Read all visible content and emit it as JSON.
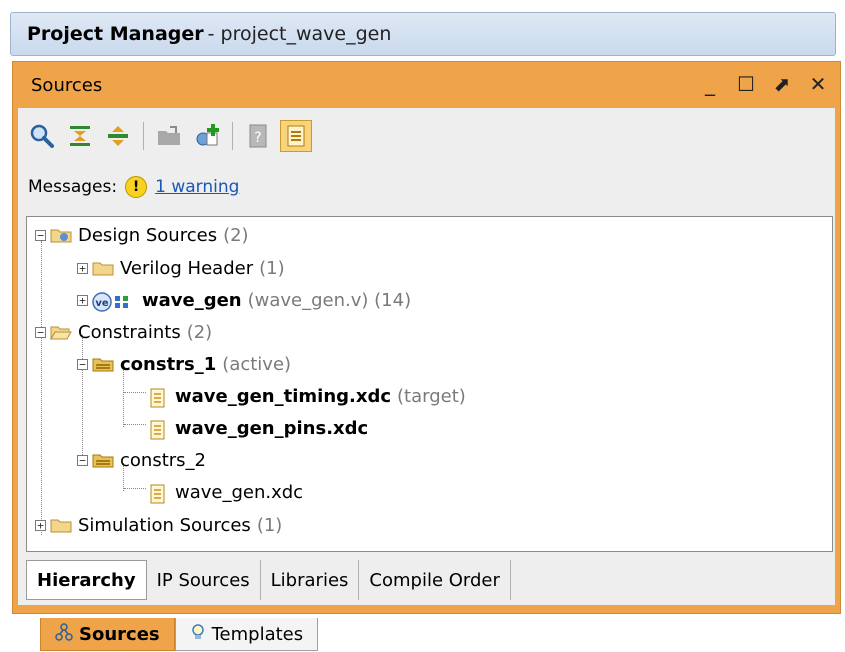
{
  "window": {
    "title_bold": "Project Manager",
    "title_rest": "- project_wave_gen"
  },
  "panel": {
    "title": "Sources",
    "controls": {
      "minimize": "_",
      "maximize": "☐",
      "float": "⬈",
      "close": "✕"
    }
  },
  "toolbar": {
    "buttons": [
      "search-icon",
      "collapse-all-icon",
      "expand-all-icon",
      "add-folder-icon",
      "add-sources-icon",
      "properties-icon",
      "hierarchy-update-icon"
    ]
  },
  "messages": {
    "label": "Messages:",
    "link": "1 warning"
  },
  "tree": [
    {
      "label": "Design Sources",
      "suffix": "(2)"
    },
    {
      "label": "Verilog Header",
      "suffix": "(1)"
    },
    {
      "label": "wave_gen",
      "suffix": "(wave_gen.v) (14)"
    },
    {
      "label": "Constraints",
      "suffix": "(2)"
    },
    {
      "label": "constrs_1",
      "suffix": "(active)"
    },
    {
      "label": "wave_gen_timing.xdc",
      "suffix": "(target)"
    },
    {
      "label": "wave_gen_pins.xdc",
      "suffix": ""
    },
    {
      "label": "constrs_2",
      "suffix": ""
    },
    {
      "label": "wave_gen.xdc",
      "suffix": ""
    },
    {
      "label": "Simulation Sources",
      "suffix": "(1)"
    }
  ],
  "tabs": [
    "Hierarchy",
    "IP Sources",
    "Libraries",
    "Compile Order"
  ],
  "window_tabs": [
    "Sources",
    "Templates"
  ],
  "colors": {
    "panel_accent": "#f0a44a",
    "link": "#1a57b6",
    "warning": "#f8d21d"
  }
}
